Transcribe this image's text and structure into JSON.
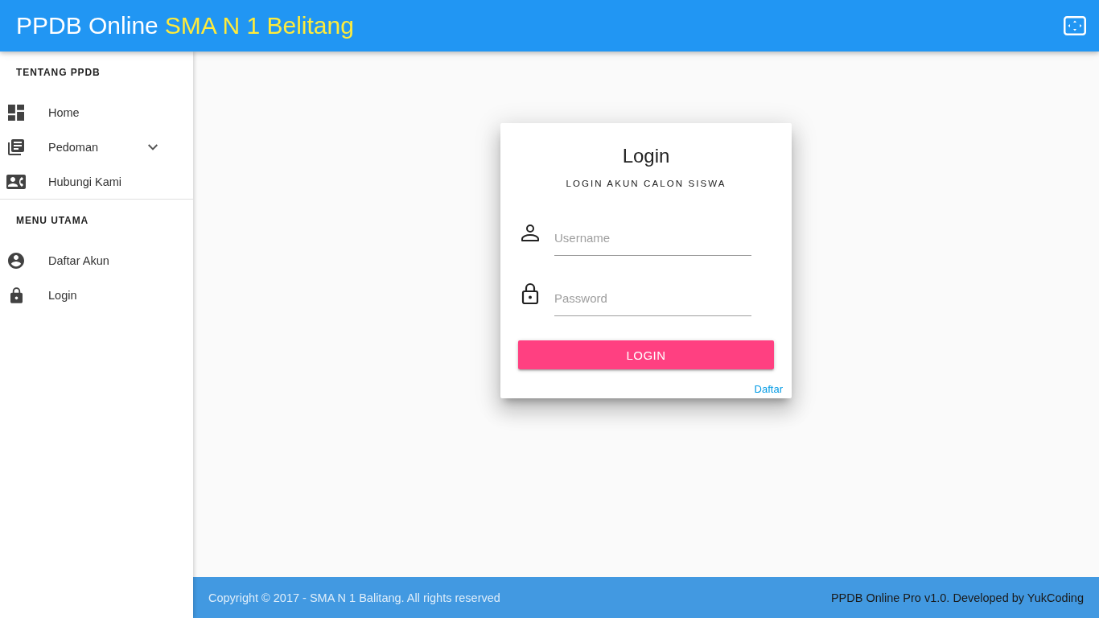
{
  "header": {
    "title": "PPDB Online",
    "school": "SMA N 1 Belitang"
  },
  "sidebar": {
    "sections": [
      {
        "heading": "TENTANG PPDB",
        "items": [
          {
            "label": "Home",
            "kind": "link"
          },
          {
            "label": "Pedoman",
            "kind": "dropdown"
          },
          {
            "label": "Hubungi Kami",
            "kind": "link"
          }
        ]
      },
      {
        "heading": "MENU UTAMA",
        "items": [
          {
            "label": "Daftar Akun",
            "kind": "link"
          },
          {
            "label": "Login",
            "kind": "link"
          }
        ]
      }
    ]
  },
  "login_card": {
    "title": "Login",
    "subtitle": "LOGIN AKUN CALON SISWA",
    "fields": [
      {
        "kind": "text",
        "placeholder": "Username"
      },
      {
        "kind": "password",
        "placeholder": "Password"
      }
    ],
    "button": "LOGIN",
    "link": "Daftar"
  },
  "footer": {
    "copyright": "Copyright © 2017 - SMA N 1 Balitang. All rights reserved",
    "credit": "PPDB Online Pro v1.0. Developed by YukCoding"
  }
}
